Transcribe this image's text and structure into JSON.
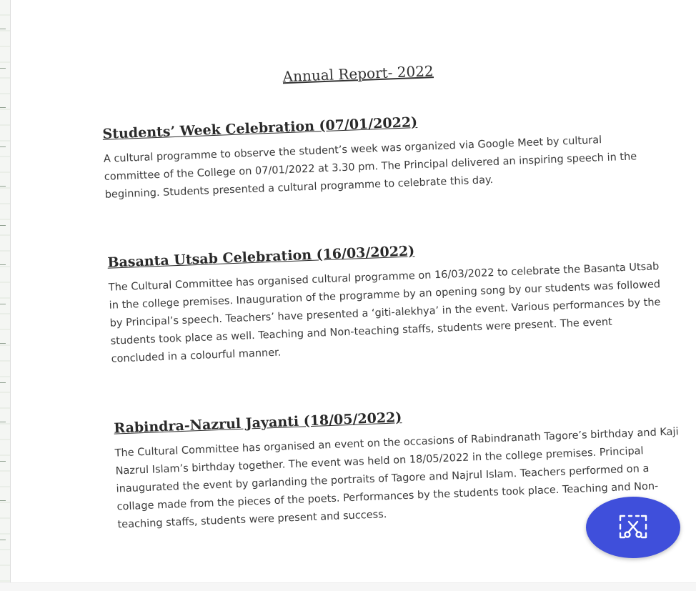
{
  "document": {
    "title": "Annual Report- 2022",
    "sections": [
      {
        "heading": "Students’ Week Celebration (07/01/2022)",
        "body": "A cultural programme to observe the student’s week was organized via Google Meet by cultural committee of the College on 07/01/2022 at 3.30 pm. The Principal delivered an inspiring speech in the beginning. Students presented a cultural programme to celebrate this day."
      },
      {
        "heading": "Basanta Utsab Celebration (16/03/2022)",
        "body": "The Cultural Committee has organised cultural programme on 16/03/2022 to celebrate the Basanta Utsab in the college premises. Inauguration of the programme by an opening song by our students was followed by Principal’s speech. Teachers’ have presented a ‘giti-alekhya’ in the event. Various performances by the students took place as well. Teaching and Non-teaching staffs, students were present. The event concluded in a colourful manner."
      },
      {
        "heading": "Rabindra-Nazrul Jayanti (18/05/2022)",
        "body": "The Cultural Committee has organised an event on the occasions of Rabindranath Tagore’s birthday and Kaji Nazrul Islam’s birthday together. The event was held on 18/05/2022 in the college premises. Principal inaugurated the event by garlanding the portraits of Tagore and Najrul Islam. Teachers performed on a collage made from the pieces of the poets. Performances by the students took place. Teaching and Non-teaching staffs, students were present and success."
      }
    ]
  },
  "fab": {
    "icon": "scissors-crop-icon",
    "color": "#3f4fdb"
  }
}
